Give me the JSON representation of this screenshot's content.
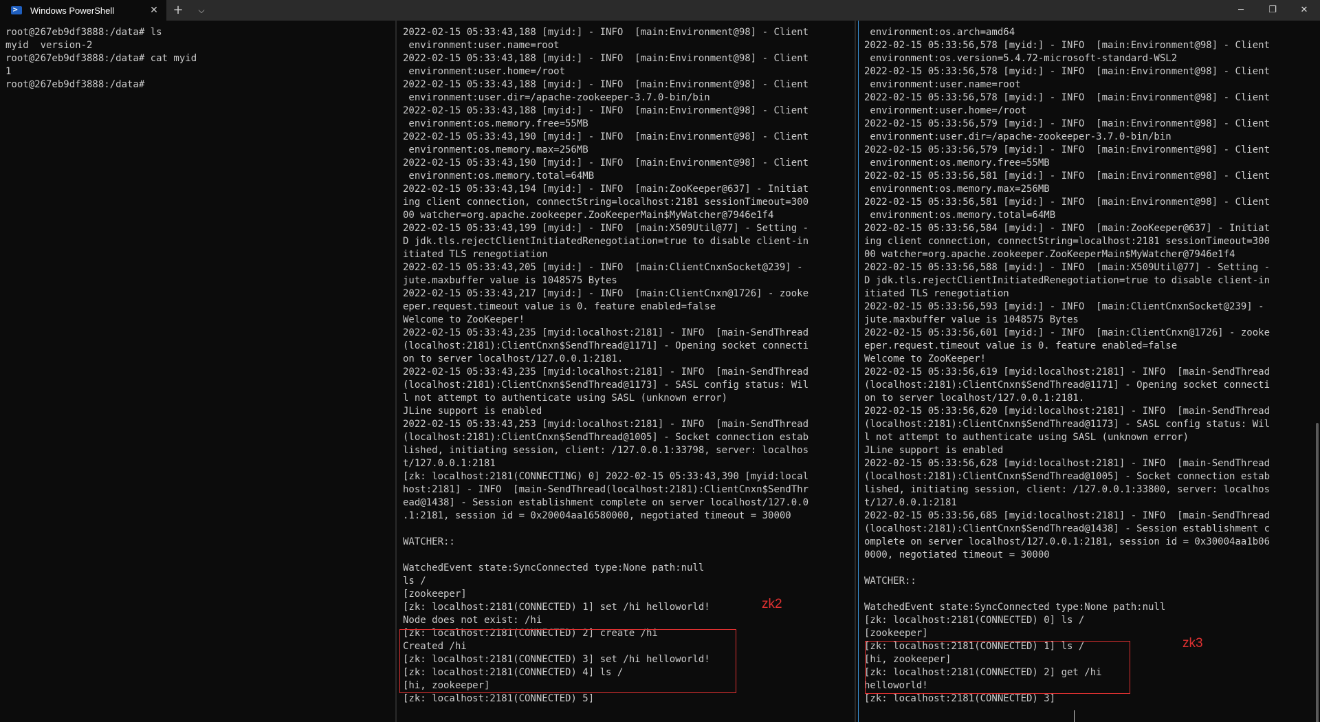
{
  "window": {
    "tab_title": "Windows PowerShell",
    "tab_close": "✕",
    "new_tab": "+",
    "tab_dropdown": "⌵",
    "minimize": "─",
    "maximize": "❐",
    "close": "✕"
  },
  "pane_left": {
    "text": "root@267eb9df3888:/data# ls\nmyid  version-2\nroot@267eb9df3888:/data# cat myid\n1\nroot@267eb9df3888:/data#"
  },
  "pane_middle": {
    "text": "2022-02-15 05:33:43,188 [myid:] - INFO  [main:Environment@98] - Client\n environment:user.name=root\n2022-02-15 05:33:43,188 [myid:] - INFO  [main:Environment@98] - Client\n environment:user.home=/root\n2022-02-15 05:33:43,188 [myid:] - INFO  [main:Environment@98] - Client\n environment:user.dir=/apache-zookeeper-3.7.0-bin/bin\n2022-02-15 05:33:43,188 [myid:] - INFO  [main:Environment@98] - Client\n environment:os.memory.free=55MB\n2022-02-15 05:33:43,190 [myid:] - INFO  [main:Environment@98] - Client\n environment:os.memory.max=256MB\n2022-02-15 05:33:43,190 [myid:] - INFO  [main:Environment@98] - Client\n environment:os.memory.total=64MB\n2022-02-15 05:33:43,194 [myid:] - INFO  [main:ZooKeeper@637] - Initiat\ning client connection, connectString=localhost:2181 sessionTimeout=300\n00 watcher=org.apache.zookeeper.ZooKeeperMain$MyWatcher@7946e1f4\n2022-02-15 05:33:43,199 [myid:] - INFO  [main:X509Util@77] - Setting -\nD jdk.tls.rejectClientInitiatedRenegotiation=true to disable client-in\nitiated TLS renegotiation\n2022-02-15 05:33:43,205 [myid:] - INFO  [main:ClientCnxnSocket@239] -\njute.maxbuffer value is 1048575 Bytes\n2022-02-15 05:33:43,217 [myid:] - INFO  [main:ClientCnxn@1726] - zooke\neper.request.timeout value is 0. feature enabled=false\nWelcome to ZooKeeper!\n2022-02-15 05:33:43,235 [myid:localhost:2181] - INFO  [main-SendThread\n(localhost:2181):ClientCnxn$SendThread@1171] - Opening socket connecti\non to server localhost/127.0.0.1:2181.\n2022-02-15 05:33:43,235 [myid:localhost:2181] - INFO  [main-SendThread\n(localhost:2181):ClientCnxn$SendThread@1173] - SASL config status: Wil\nl not attempt to authenticate using SASL (unknown error)\nJLine support is enabled\n2022-02-15 05:33:43,253 [myid:localhost:2181] - INFO  [main-SendThread\n(localhost:2181):ClientCnxn$SendThread@1005] - Socket connection estab\nlished, initiating session, client: /127.0.0.1:33798, server: localhos\nt/127.0.0.1:2181\n[zk: localhost:2181(CONNECTING) 0] 2022-02-15 05:33:43,390 [myid:local\nhost:2181] - INFO  [main-SendThread(localhost:2181):ClientCnxn$SendThr\nead@1438] - Session establishment complete on server localhost/127.0.0\n.1:2181, session id = 0x20004aa16580000, negotiated timeout = 30000\n\nWATCHER::\n\nWatchedEvent state:SyncConnected type:None path:null\nls /\n[zookeeper]\n[zk: localhost:2181(CONNECTED) 1] set /hi helloworld!\nNode does not exist: /hi\n[zk: localhost:2181(CONNECTED) 2] create /hi\nCreated /hi\n[zk: localhost:2181(CONNECTED) 3] set /hi helloworld!\n[zk: localhost:2181(CONNECTED) 4] ls /\n[hi, zookeeper]\n[zk: localhost:2181(CONNECTED) 5]",
    "annotation": "zk2"
  },
  "pane_right": {
    "text": " environment:os.arch=amd64\n2022-02-15 05:33:56,578 [myid:] - INFO  [main:Environment@98] - Client\n environment:os.version=5.4.72-microsoft-standard-WSL2\n2022-02-15 05:33:56,578 [myid:] - INFO  [main:Environment@98] - Client\n environment:user.name=root\n2022-02-15 05:33:56,578 [myid:] - INFO  [main:Environment@98] - Client\n environment:user.home=/root\n2022-02-15 05:33:56,579 [myid:] - INFO  [main:Environment@98] - Client\n environment:user.dir=/apache-zookeeper-3.7.0-bin/bin\n2022-02-15 05:33:56,579 [myid:] - INFO  [main:Environment@98] - Client\n environment:os.memory.free=55MB\n2022-02-15 05:33:56,581 [myid:] - INFO  [main:Environment@98] - Client\n environment:os.memory.max=256MB\n2022-02-15 05:33:56,581 [myid:] - INFO  [main:Environment@98] - Client\n environment:os.memory.total=64MB\n2022-02-15 05:33:56,584 [myid:] - INFO  [main:ZooKeeper@637] - Initiat\ning client connection, connectString=localhost:2181 sessionTimeout=300\n00 watcher=org.apache.zookeeper.ZooKeeperMain$MyWatcher@7946e1f4\n2022-02-15 05:33:56,588 [myid:] - INFO  [main:X509Util@77] - Setting -\nD jdk.tls.rejectClientInitiatedRenegotiation=true to disable client-in\nitiated TLS renegotiation\n2022-02-15 05:33:56,593 [myid:] - INFO  [main:ClientCnxnSocket@239] -\njute.maxbuffer value is 1048575 Bytes\n2022-02-15 05:33:56,601 [myid:] - INFO  [main:ClientCnxn@1726] - zooke\neper.request.timeout value is 0. feature enabled=false\nWelcome to ZooKeeper!\n2022-02-15 05:33:56,619 [myid:localhost:2181] - INFO  [main-SendThread\n(localhost:2181):ClientCnxn$SendThread@1171] - Opening socket connecti\non to server localhost/127.0.0.1:2181.\n2022-02-15 05:33:56,620 [myid:localhost:2181] - INFO  [main-SendThread\n(localhost:2181):ClientCnxn$SendThread@1173] - SASL config status: Wil\nl not attempt to authenticate using SASL (unknown error)\nJLine support is enabled\n2022-02-15 05:33:56,628 [myid:localhost:2181] - INFO  [main-SendThread\n(localhost:2181):ClientCnxn$SendThread@1005] - Socket connection estab\nlished, initiating session, client: /127.0.0.1:33800, server: localhos\nt/127.0.0.1:2181\n2022-02-15 05:33:56,685 [myid:localhost:2181] - INFO  [main-SendThread\n(localhost:2181):ClientCnxn$SendThread@1438] - Session establishment c\nomplete on server localhost/127.0.0.1:2181, session id = 0x30004aa1b06\n0000, negotiated timeout = 30000\n\nWATCHER::\n\nWatchedEvent state:SyncConnected type:None path:null\n[zk: localhost:2181(CONNECTED) 0] ls /\n[zookeeper]\n[zk: localhost:2181(CONNECTED) 1] ls /\n[hi, zookeeper]\n[zk: localhost:2181(CONNECTED) 2] get /hi\nhelloworld!\n[zk: localhost:2181(CONNECTED) 3] ",
    "annotation": "zk3"
  },
  "colors": {
    "terminal_bg": "#0c0c0c",
    "terminal_fg": "#cccccc",
    "annotation_red": "#e03131",
    "active_pane_border": "#3a96dd",
    "tab_icon_blue": "#1f5fbf"
  }
}
